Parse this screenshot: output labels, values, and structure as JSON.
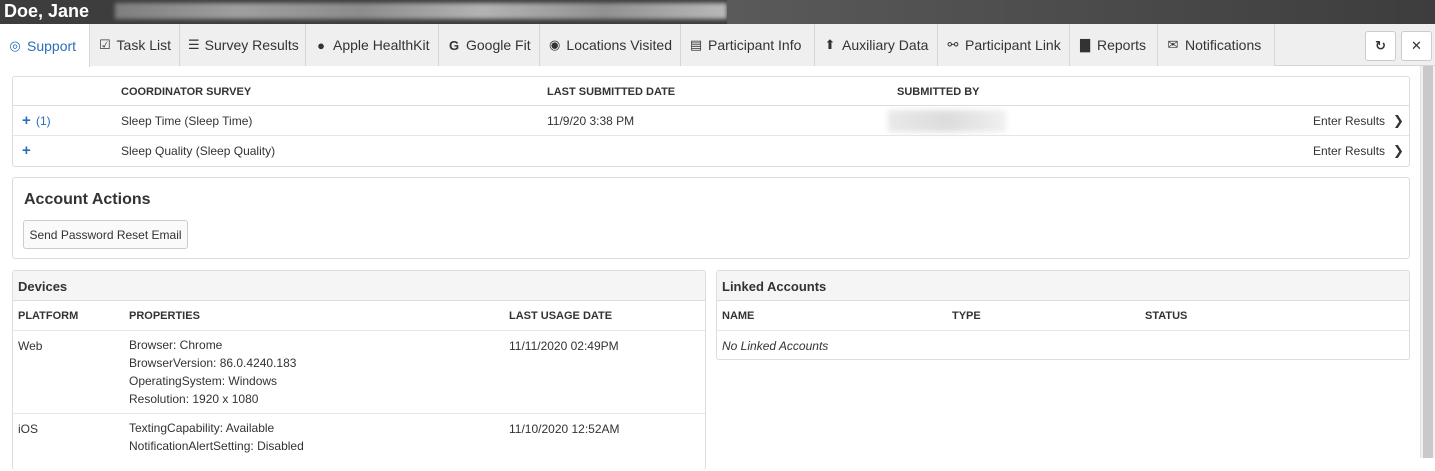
{
  "header": {
    "name": "Doe, Jane"
  },
  "tabs": [
    {
      "label": "Support",
      "icon": "support-icon",
      "glyph": "◎"
    },
    {
      "label": "Task List",
      "icon": "calendar-check-icon",
      "glyph": "☑"
    },
    {
      "label": "Survey Results",
      "icon": "list-icon",
      "glyph": "☰"
    },
    {
      "label": "Apple HealthKit",
      "icon": "apple-icon",
      "glyph": "●"
    },
    {
      "label": "Google Fit",
      "icon": "google-icon",
      "glyph": "G"
    },
    {
      "label": "Locations Visited",
      "icon": "globe-icon",
      "glyph": "◉"
    },
    {
      "label": "Participant Info",
      "icon": "id-card-icon",
      "glyph": "▤"
    },
    {
      "label": "Auxiliary Data",
      "icon": "upload-icon",
      "glyph": "⬆"
    },
    {
      "label": "Participant Link",
      "icon": "link-icon",
      "glyph": "⚯"
    },
    {
      "label": "Reports",
      "icon": "bar-chart-icon",
      "glyph": "▇"
    },
    {
      "label": "Notifications",
      "icon": "envelope-open-icon",
      "glyph": "✉"
    }
  ],
  "toolbar": {
    "refresh_glyph": "↻",
    "close_glyph": "✕"
  },
  "survey": {
    "headers": {
      "survey": "COORDINATOR SURVEY",
      "last_submitted": "LAST SUBMITTED DATE",
      "submitted_by": "SUBMITTED BY"
    },
    "rows": [
      {
        "expand": "+",
        "count": "(1)",
        "name": "Sleep Time (Sleep Time)",
        "date": "11/9/20 3:38 PM",
        "action": "Enter Results",
        "chevron": "❯"
      },
      {
        "expand": "+",
        "count": "",
        "name": "Sleep Quality (Sleep Quality)",
        "date": "",
        "action": "Enter Results",
        "chevron": "❯"
      }
    ]
  },
  "account_actions": {
    "title": "Account Actions",
    "reset_button": "Send Password Reset Email"
  },
  "devices": {
    "title": "Devices",
    "headers": {
      "platform": "PLATFORM",
      "properties": "PROPERTIES",
      "last_usage": "LAST USAGE DATE"
    },
    "rows": [
      {
        "platform": "Web",
        "properties": [
          "Browser: Chrome",
          "BrowserVersion: 86.0.4240.183",
          "OperatingSystem: Windows",
          "Resolution: 1920 x 1080"
        ],
        "last_usage": "11/11/2020 02:49PM"
      },
      {
        "platform": "iOS",
        "properties": [
          "TextingCapability: Available",
          "NotificationAlertSetting: Disabled"
        ],
        "last_usage": "11/10/2020 12:52AM"
      }
    ]
  },
  "linked_accounts": {
    "title": "Linked Accounts",
    "headers": {
      "name": "NAME",
      "type": "TYPE",
      "status": "STATUS"
    },
    "empty": "No Linked Accounts"
  },
  "colors": {
    "accent": "#2a6ebb",
    "titlebar": "#3d3d3d",
    "tabbar": "#efefef"
  }
}
